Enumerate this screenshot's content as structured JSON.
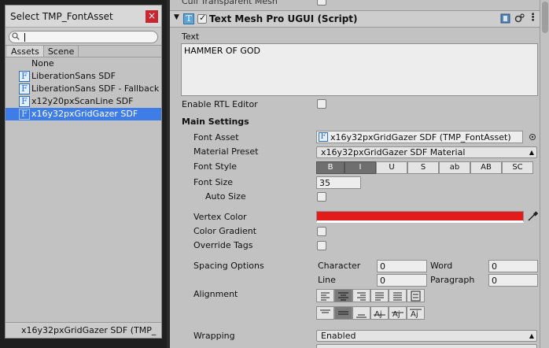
{
  "picker": {
    "title": "Select TMP_FontAsset",
    "close_label": "×",
    "search_value": "",
    "tabs": [
      {
        "label": "Assets"
      },
      {
        "label": "Scene"
      }
    ],
    "items": [
      {
        "label": "None"
      },
      {
        "label": "LiberationSans SDF"
      },
      {
        "label": "LiberationSans SDF - Fallback"
      },
      {
        "label": "x12y20pxScanLine SDF"
      },
      {
        "label": "x16y32pxGridGazer SDF"
      }
    ],
    "selected_index": 4,
    "footer": "x16y32pxGridGazer SDF (TMP_"
  },
  "inspector": {
    "cut_label": "Cull Transparent Mesh",
    "component_title": "Text Mesh Pro UGUI (Script)",
    "text_label": "Text",
    "text_value": "HAMMER OF GOD",
    "rtl_label": "Enable RTL Editor",
    "main_settings": "Main Settings",
    "font_asset_label": "Font Asset",
    "font_asset_value": "x16y32pxGridGazer SDF (TMP_FontAsset)",
    "material_preset_label": "Material Preset",
    "material_preset_value": "x16y32pxGridGazer SDF Material",
    "font_style_label": "Font Style",
    "font_style_buttons": [
      {
        "label": "B",
        "on": true
      },
      {
        "label": "I",
        "on": true
      },
      {
        "label": "U",
        "on": false
      },
      {
        "label": "S",
        "on": false
      },
      {
        "label": "ab",
        "on": false
      },
      {
        "label": "AB",
        "on": false
      },
      {
        "label": "SC",
        "on": false
      }
    ],
    "font_size_label": "Font Size",
    "font_size_value": "35",
    "auto_size_label": "Auto Size",
    "vertex_color_label": "Vertex Color",
    "vertex_color": "#e31b1b",
    "color_gradient_label": "Color Gradient",
    "override_tags_label": "Override Tags",
    "spacing_label": "Spacing Options",
    "character_label": "Character",
    "character_value": "0",
    "word_label": "Word",
    "word_value": "0",
    "line_label": "Line",
    "line_value": "0",
    "paragraph_label": "Paragraph",
    "paragraph_value": "0",
    "alignment_label": "Alignment",
    "wrapping_label": "Wrapping",
    "wrapping_value": "Enabled"
  }
}
